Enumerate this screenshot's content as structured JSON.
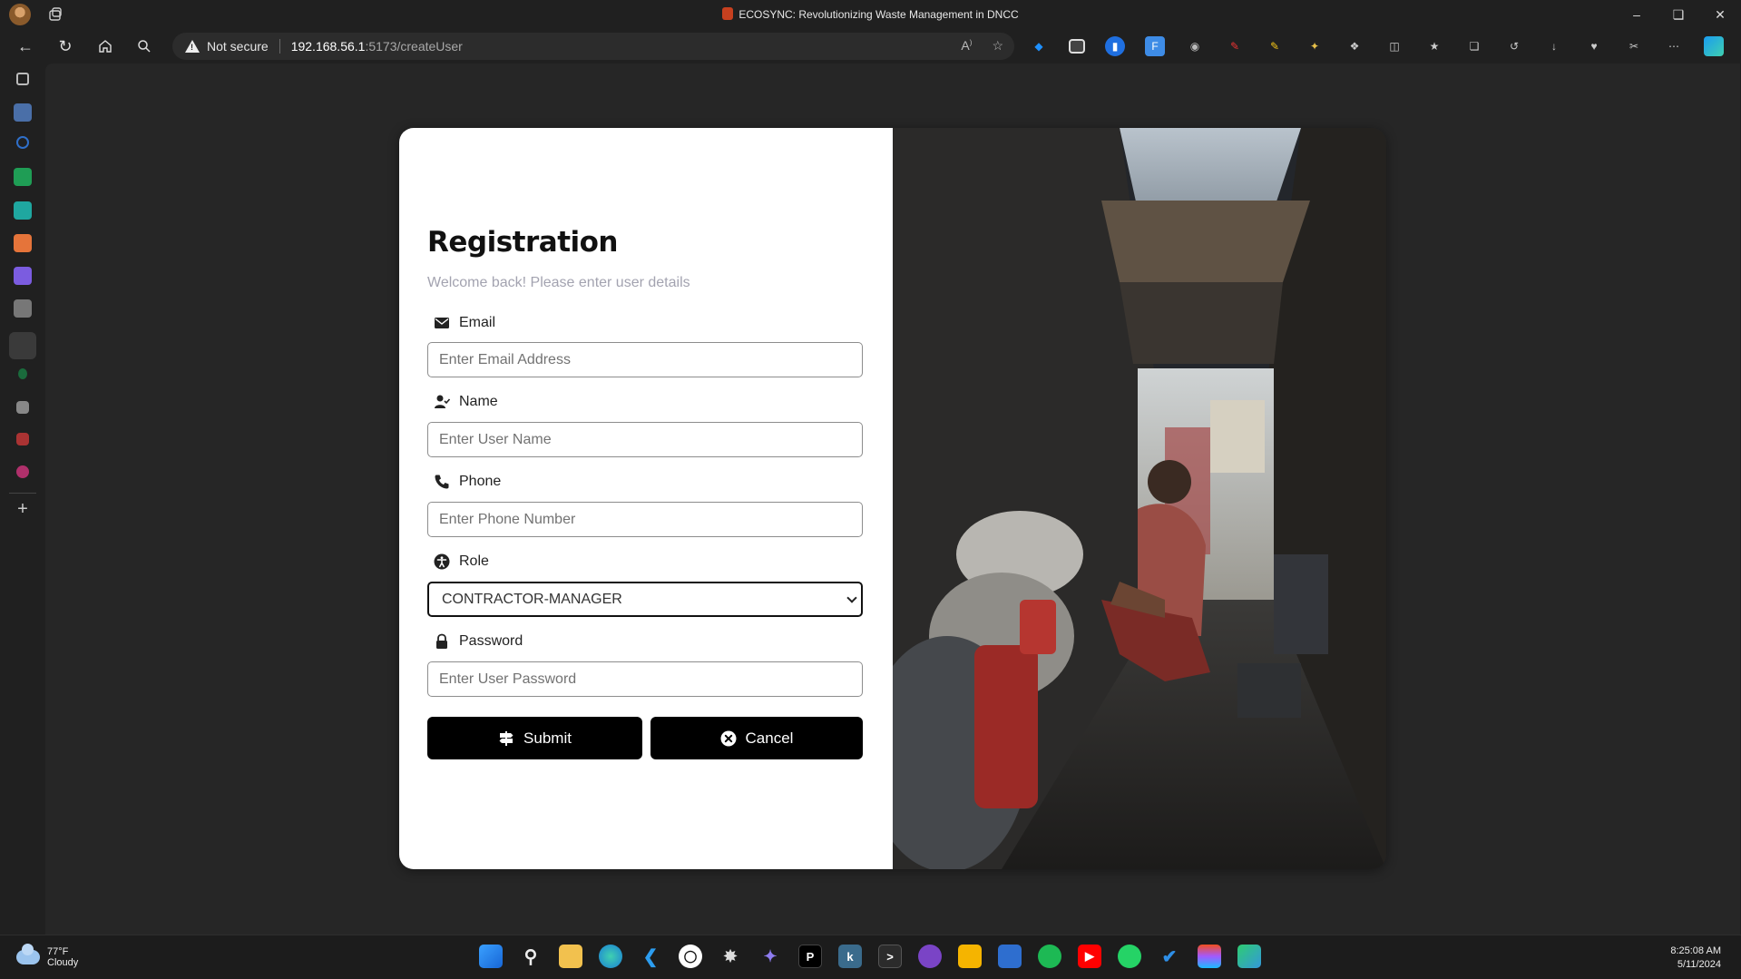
{
  "window": {
    "title": "ECOSYNC: Revolutionizing Waste Management in DNCC"
  },
  "address_bar": {
    "security_label": "Not secure",
    "url_host": "192.168.56.1",
    "url_path": ":5173/createUser"
  },
  "form": {
    "title": "Registration",
    "subtitle": "Welcome back! Please enter user details",
    "email": {
      "label": "Email",
      "placeholder": "Enter Email Address",
      "icon": "envelope-icon"
    },
    "name": {
      "label": "Name",
      "placeholder": "Enter User Name",
      "icon": "user-check-icon"
    },
    "phone": {
      "label": "Phone",
      "placeholder": "Enter Phone Number",
      "icon": "phone-icon"
    },
    "role": {
      "label": "Role",
      "selected": "CONTRACTOR-MANAGER",
      "icon": "accessibility-icon"
    },
    "password": {
      "label": "Password",
      "placeholder": "Enter User Password",
      "icon": "lock-icon"
    },
    "submit_label": "Submit",
    "cancel_label": "Cancel"
  },
  "taskbar": {
    "temperature": "77°F",
    "weather": "Cloudy",
    "time": "8:25:08 AM",
    "date": "5/11/2024"
  },
  "colors": {
    "browser_chrome": "#202020",
    "page_background": "#262626",
    "card_background": "#ffffff",
    "button_background": "#000000",
    "edge_accent": "#1a9cf0"
  }
}
